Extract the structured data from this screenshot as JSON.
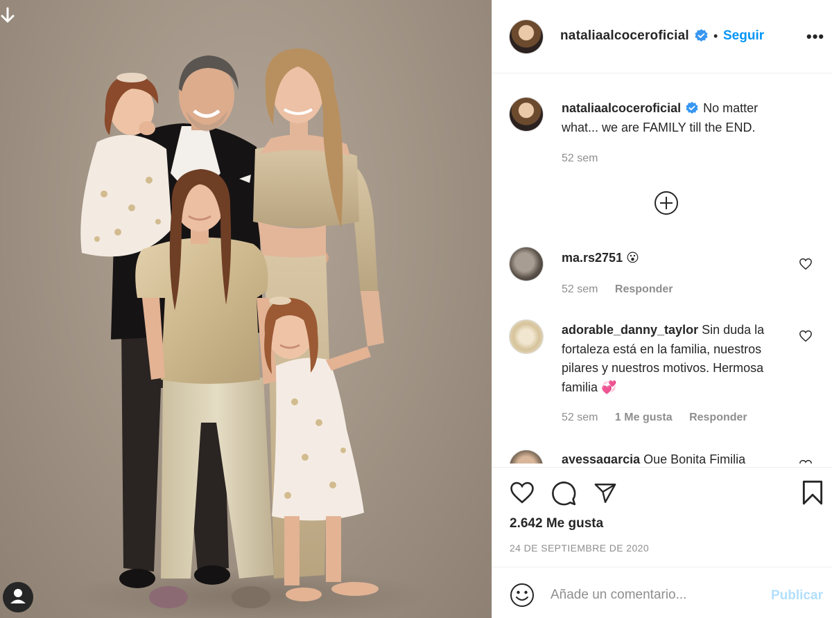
{
  "colors": {
    "accent": "#0095f6",
    "publish_disabled": "#b2dffc",
    "text": "#262626",
    "muted": "#8e8e8e",
    "divider": "#efefef"
  },
  "icons": {
    "download": "arrow-down-icon",
    "tags": "user-tag-icon",
    "verified": "verified-badge-icon",
    "more": "more-options-icon",
    "load_more": "plus-circle-icon",
    "like": "heart-icon",
    "comment": "comment-icon",
    "share": "share-icon",
    "save": "bookmark-icon",
    "emoji": "emoji-icon"
  },
  "header": {
    "username": "natalia alcoceroficial",
    "username_display": "nataliaalcoceroficial",
    "separator": "•",
    "follow_label": "Seguir",
    "more_label": "•••"
  },
  "caption": {
    "username": "nataliaalcoceroficial",
    "text": "No matter what... we are FAMILY till the END.",
    "time": "52 sem"
  },
  "comments": [
    {
      "username": "ma.rs2751",
      "text": "😮",
      "time": "52 sem",
      "reply_label": "Responder"
    },
    {
      "username": "adorable_danny_taylor",
      "text": "Sin duda la fortaleza está en la familia, nuestros pilares y nuestros motivos. Hermosa familia 💞",
      "time": "52 sem",
      "likes_label": "1 Me gusta",
      "reply_label": "Responder"
    },
    {
      "username": "ayessagarcia",
      "text": "Que Bonita Fimilia",
      "time": "",
      "reply_label": ""
    }
  ],
  "actions": {
    "likes": "2.642 Me gusta",
    "date": "24 DE SEPTIEMBRE DE 2020"
  },
  "composer": {
    "placeholder": "Añade un comentario...",
    "publish_label": "Publicar"
  }
}
